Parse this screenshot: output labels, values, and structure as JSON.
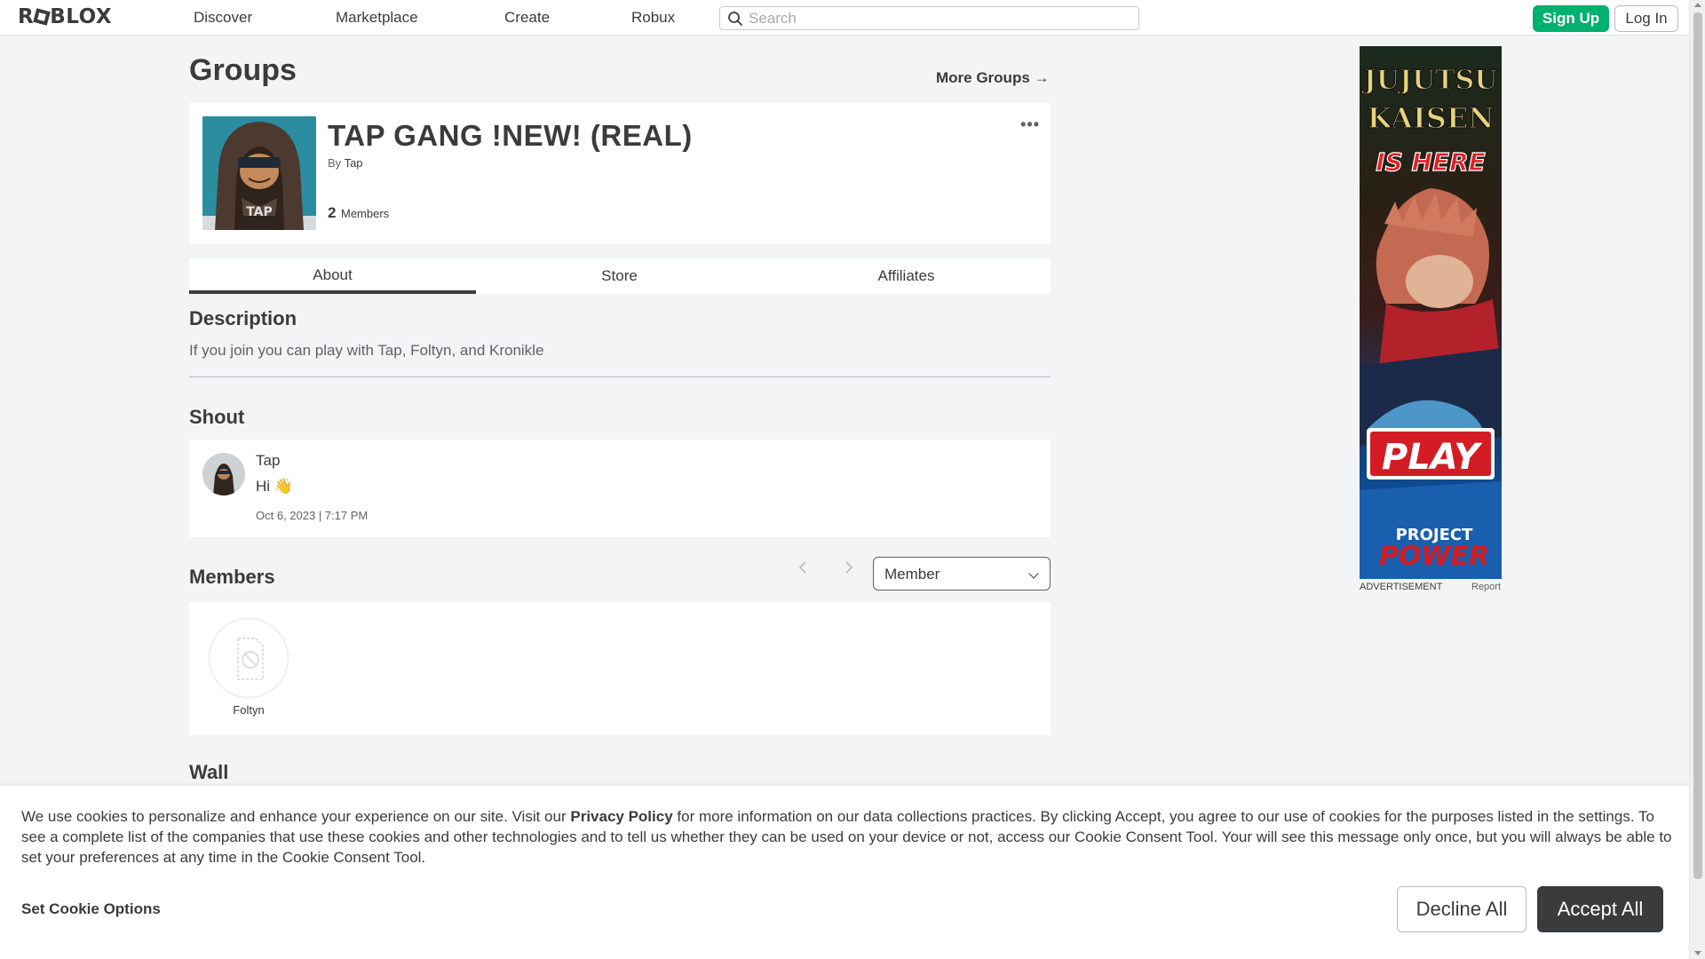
{
  "nav": {
    "logo": "ROBLOX",
    "links": [
      "Discover",
      "Marketplace",
      "Create",
      "Robux"
    ],
    "search_placeholder": "Search",
    "signup_label": "Sign Up",
    "login_label": "Log In"
  },
  "page": {
    "title": "Groups",
    "more_groups": "More Groups →"
  },
  "group": {
    "name": "TAP GANG !NEW! (REAL)",
    "by_prefix": "By",
    "owner": "Tap",
    "member_count": "2",
    "member_label": "Members",
    "menu": "•••"
  },
  "tabs": [
    {
      "label": "About",
      "active": true
    },
    {
      "label": "Store",
      "active": false
    },
    {
      "label": "Affiliates",
      "active": false
    }
  ],
  "description": {
    "heading": "Description",
    "text": "If you join you can play with Tap, Foltyn, and Kronikle"
  },
  "shout": {
    "heading": "Shout",
    "user": "Tap",
    "message": "Hi 👋",
    "date": "Oct 6, 2023 | 7:17 PM"
  },
  "members": {
    "heading": "Members",
    "role_selected": "Member",
    "list": [
      {
        "name": "Foltyn"
      }
    ]
  },
  "wall": {
    "heading": "Wall"
  },
  "ad": {
    "label": "ADVERTISEMENT",
    "report": "Report",
    "line1": "JUJUTSU",
    "line2": "KAISEN",
    "line3": "IS HERE",
    "cta": "PLAY",
    "brand_top": "PROJECT",
    "brand_bottom": "POWER"
  },
  "cookie": {
    "text_before": "We use cookies to personalize and enhance your experience on our site. Visit our ",
    "link": "Privacy Policy",
    "text_after": " for more information on our data collections practices. By clicking Accept, you agree to our use of cookies for the purposes listed in the settings. To see a complete list of the companies that use these cookies and other technologies and to tell us whether they can be used on your device or not, access our Cookie Consent Tool. Your will see this message only once, but you will always be able to set your preferences at any time in the Cookie Consent Tool.",
    "set_options": "Set Cookie Options",
    "decline": "Decline All",
    "accept": "Accept All"
  },
  "colors": {
    "signup_green": "#00b06f",
    "accept_dark": "#393b3d",
    "page_bg": "#f2f4f5"
  }
}
